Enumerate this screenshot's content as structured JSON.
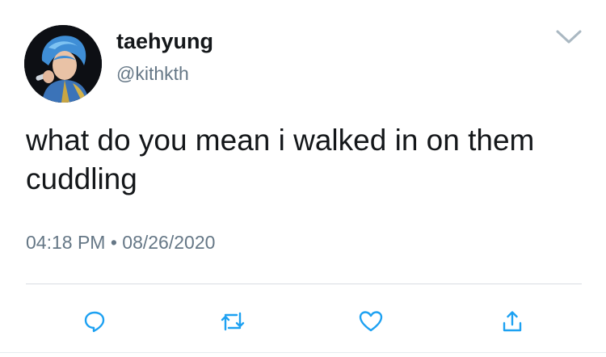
{
  "tweet": {
    "display_name": "taehyung",
    "handle": "@kithkth",
    "text": "what do you mean i walked in on them cuddling",
    "time": "04:18 PM",
    "separator": "•",
    "date": "08/26/2020"
  },
  "icons": {
    "more": "chevron-down-icon",
    "reply": "reply-icon",
    "retweet": "retweet-icon",
    "like": "heart-icon",
    "share": "share-icon"
  },
  "colors": {
    "text": "#14171a",
    "secondary": "#657786",
    "icon": "#1da1f2",
    "divider": "#d8dde2"
  }
}
